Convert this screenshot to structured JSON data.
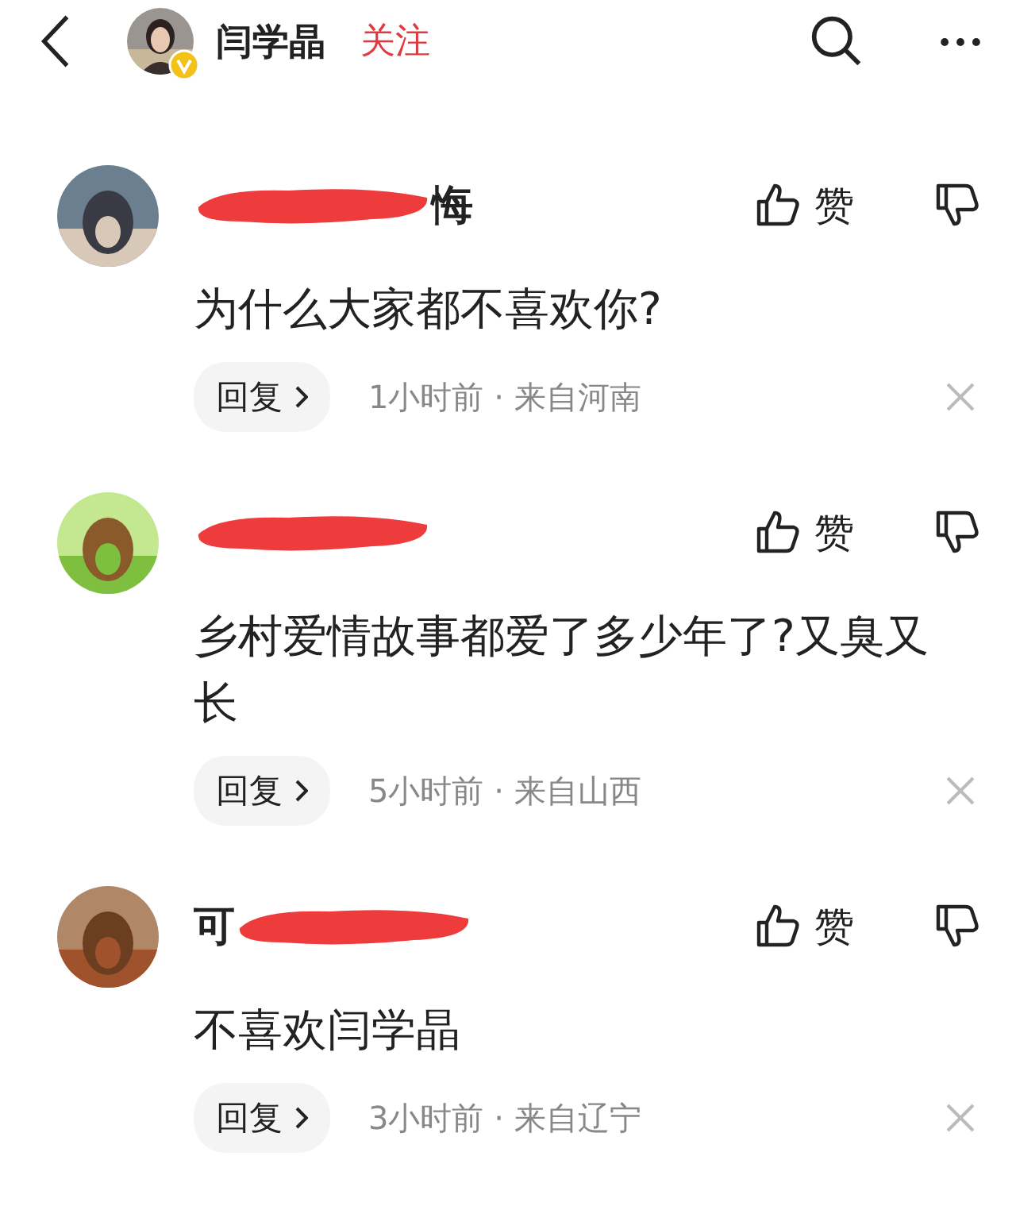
{
  "header": {
    "title": "闫学晶",
    "follow": "关注",
    "verified": true
  },
  "comments": [
    {
      "name_after": "悔",
      "text": "为什么大家都不喜欢你?",
      "like": "赞",
      "reply": "回复",
      "meta": "1小时前 · 来自河南"
    },
    {
      "text": "乡村爱情故事都爱了多少年了?又臭又长",
      "like": "赞",
      "reply": "回复",
      "meta": "5小时前 · 来自山西"
    },
    {
      "name_before": "可",
      "text": "不喜欢闫学晶",
      "like": "赞",
      "reply": "回复",
      "meta": "3小时前 · 来自辽宁"
    }
  ]
}
